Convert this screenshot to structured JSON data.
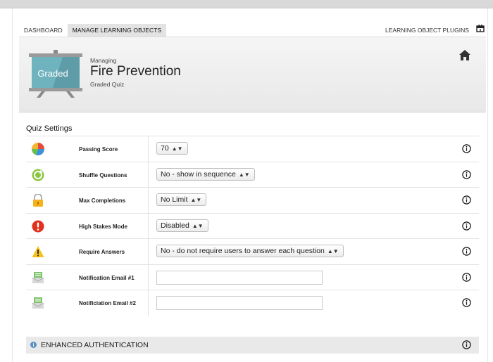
{
  "nav": {
    "tabs": [
      {
        "label": "DASHBOARD",
        "active": false
      },
      {
        "label": "MANAGE LEARNING OBJECTS",
        "active": true
      }
    ],
    "plugins_label": "LEARNING OBJECT PLUGINS",
    "plugins_icon": "plugin-box-icon"
  },
  "header": {
    "subtitle": "Managing",
    "title": "Fire Prevention",
    "type": "Graded Quiz",
    "badge": "Graded",
    "badge_color": "#6fb3bf",
    "home_icon": "home-icon"
  },
  "quiz_settings": {
    "title": "Quiz Settings",
    "rows": [
      {
        "icon": "pie-chart-icon",
        "label": "Passing Score",
        "control": "select",
        "value": "70"
      },
      {
        "icon": "shuffle-icon",
        "label": "Shuffle Questions",
        "control": "select",
        "value": "No - show in sequence"
      },
      {
        "icon": "lock-icon",
        "label": "Max Completions",
        "control": "select",
        "value": "No Limit"
      },
      {
        "icon": "alert-circle-icon",
        "label": "High Stakes Mode",
        "control": "select",
        "value": "Disabled"
      },
      {
        "icon": "warning-triangle-icon",
        "label": "Require Answers",
        "control": "select",
        "value": "No - do not require users to answer each question"
      },
      {
        "icon": "email-icon",
        "label": "Notification Email #1",
        "control": "text",
        "value": ""
      },
      {
        "icon": "email-icon",
        "label": "Notificiation Email #2",
        "control": "text",
        "value": ""
      }
    ]
  },
  "enhanced_auth": {
    "title": "ENHANCED AUTHENTICATION"
  },
  "colors": {
    "accent_tab_bg": "#e3e3e3",
    "auth_dot": "#5a8fc4"
  }
}
